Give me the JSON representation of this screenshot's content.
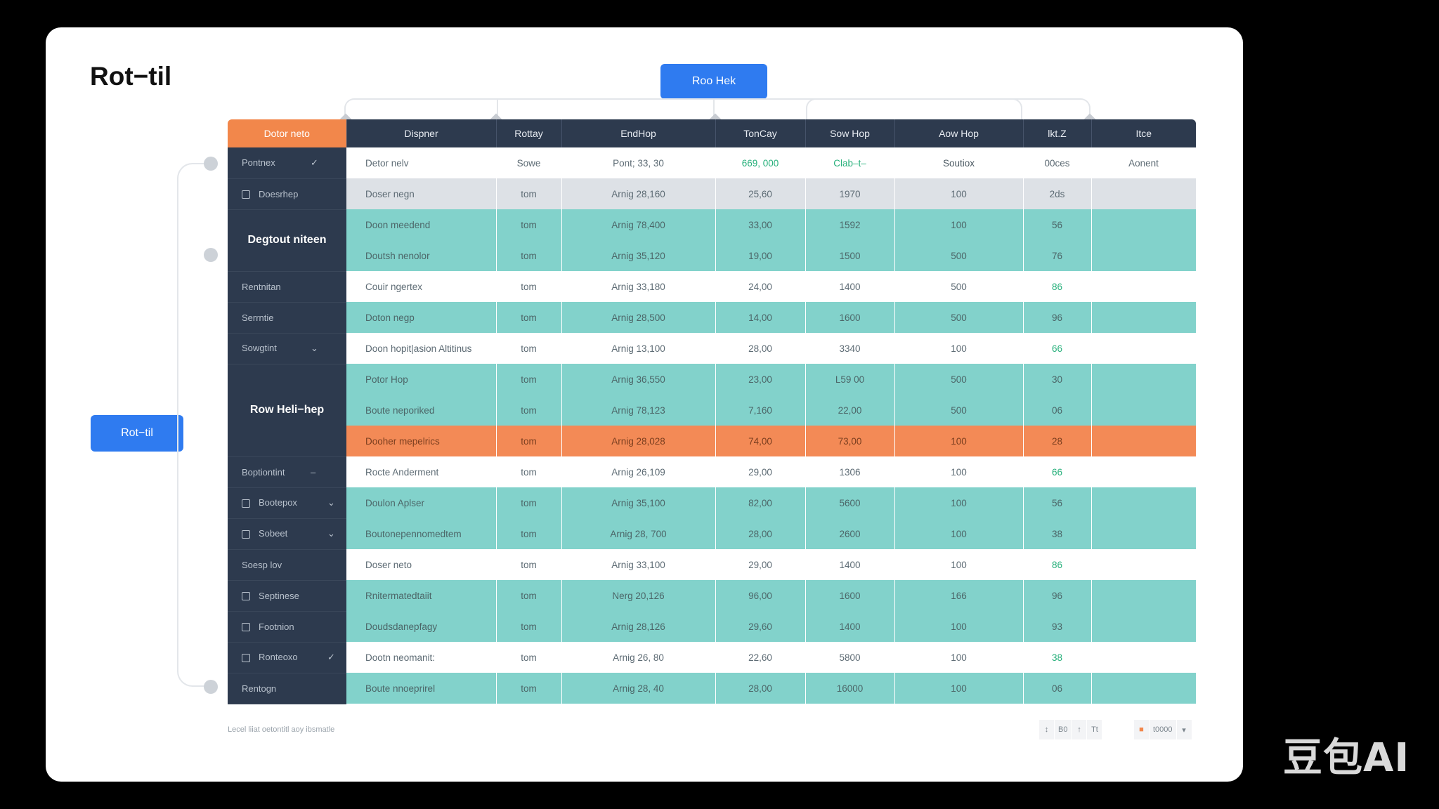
{
  "page": {
    "title": "Rot−til"
  },
  "top_button": {
    "label": "Roo Hek"
  },
  "side_button": {
    "label": "Rot−til"
  },
  "table": {
    "headers": [
      "Dotor neto",
      "Dispner",
      "Rottay",
      "EndHop",
      "TonCay",
      "Sow Hop",
      "Aow Hop",
      "lkt.Z",
      "Itce"
    ],
    "groups": {
      "g1": "Degtout niteen",
      "g2": "Row Heli−hep"
    },
    "rows": [
      {
        "style": "white",
        "side": "Pontnex",
        "mark": "✓",
        "box": false,
        "cells": [
          "Detor nelv",
          "Sowe",
          "Pont; 33, 30",
          "669, 000",
          "Clab–t–",
          "Soutiox",
          "00ces",
          "Aonent"
        ]
      },
      {
        "style": "gray",
        "side": "Doesrhep",
        "mark": "",
        "box": true,
        "cells": [
          "Doser negn",
          "tom",
          "Arnig 28,160",
          "25,60",
          "1970",
          "100",
          "2ds",
          ""
        ]
      },
      {
        "style": "teal",
        "group": "g1",
        "cells": [
          "Doon meedend",
          "tom",
          "Arnig 78,400",
          "33,00",
          "1592",
          "100",
          "56",
          ""
        ]
      },
      {
        "style": "teal",
        "group": "g1",
        "cells": [
          "Doutsh nenolor",
          "tom",
          "Arnig 35,120",
          "19,00",
          "1500",
          "500",
          "76",
          ""
        ]
      },
      {
        "style": "white",
        "side": "Rentnitan",
        "mark": "",
        "box": false,
        "cells": [
          "Couir ngertex",
          "tom",
          "Arnig 33,180",
          "24,00",
          "1400",
          "500",
          "86",
          ""
        ]
      },
      {
        "style": "teal",
        "side": "Serrntie",
        "mark": "",
        "box": false,
        "cells": [
          "Doton negp",
          "tom",
          "Arnig 28,500",
          "14,00",
          "1600",
          "500",
          "96",
          ""
        ]
      },
      {
        "style": "white",
        "side": "Sowgtint",
        "mark": "⌄",
        "box": false,
        "cells": [
          "Doon hopit|asion Altitinus",
          "tom",
          "Arnig 13,100",
          "28,00",
          "3340",
          "100",
          "66",
          ""
        ]
      },
      {
        "style": "teal",
        "group": "g2",
        "cells": [
          "Potor Hop",
          "tom",
          "Arnig 36,550",
          "23,00",
          "L59 00",
          "500",
          "30",
          ""
        ]
      },
      {
        "style": "teal",
        "group": "g2",
        "cells": [
          "Boute neporiked",
          "tom",
          "Arnig 78,123",
          "7,160",
          "22,00",
          "500",
          "06",
          ""
        ]
      },
      {
        "style": "orange",
        "group": "g2",
        "cells": [
          "Dooher mepelrics",
          "tom",
          "Arnig 28,028",
          "74,00",
          "73,00",
          "100",
          "28",
          ""
        ]
      },
      {
        "style": "white",
        "side": "Boptiontint",
        "mark": "–",
        "box": false,
        "cells": [
          "Rocte Anderment",
          "tom",
          "Arnig 26,109",
          "29,00",
          "1306",
          "100",
          "66",
          ""
        ]
      },
      {
        "style": "teal",
        "side": "Bootepox",
        "mark": "⌄",
        "box": true,
        "cells": [
          "Doulon Aplser",
          "tom",
          "Arnig 35,100",
          "82,00",
          "5600",
          "100",
          "56",
          ""
        ]
      },
      {
        "style": "teal",
        "side": "Sobeet",
        "mark": "⌄",
        "box": true,
        "cells": [
          "Boutonepennomedtem",
          "tom",
          "Arnig 28, 700",
          "28,00",
          "2600",
          "100",
          "38",
          ""
        ]
      },
      {
        "style": "white",
        "side": "Soesp lov",
        "mark": "",
        "box": false,
        "cells": [
          "Doser neto",
          "tom",
          "Arnig 33,100",
          "29,00",
          "1400",
          "100",
          "86",
          ""
        ]
      },
      {
        "style": "teal",
        "side": "Septinese",
        "mark": "",
        "box": true,
        "cells": [
          "Rnitermatedtaiit",
          "tom",
          "Nerg 20,126",
          "96,00",
          "1600",
          "166",
          "96",
          ""
        ]
      },
      {
        "style": "teal",
        "side": "Footnion",
        "mark": "",
        "box": true,
        "cells": [
          "Doudsdanepfagy",
          "tom",
          "Arnig 28,126",
          "29,60",
          "1400",
          "100",
          "93",
          ""
        ]
      },
      {
        "style": "white",
        "side": "Ronteoxo",
        "mark": "✓",
        "box": true,
        "cells": [
          "Dootn neomanit:",
          "tom",
          "Arnig 26, 80",
          "22,60",
          "5800",
          "100",
          "38",
          ""
        ]
      },
      {
        "style": "teal",
        "side": "Rentogn",
        "mark": "",
        "box": false,
        "cells": [
          "Boute nnoeprirel",
          "tom",
          "Arnig 28, 40",
          "28,00",
          "16000",
          "100",
          "06",
          ""
        ]
      }
    ]
  },
  "footer": {
    "note": "Lecel liiat oetontitl aoy ibsmatle",
    "pager": [
      "↕",
      "B0",
      "↑",
      "Tt"
    ],
    "page_size": "t0000",
    "page_size_arrow": "▾"
  },
  "watermark": "豆包AI",
  "colors": {
    "accent_blue": "#2f7bf0",
    "header_dark": "#2d3a4e",
    "orange": "#f2874b",
    "teal": "#82d2cb"
  }
}
